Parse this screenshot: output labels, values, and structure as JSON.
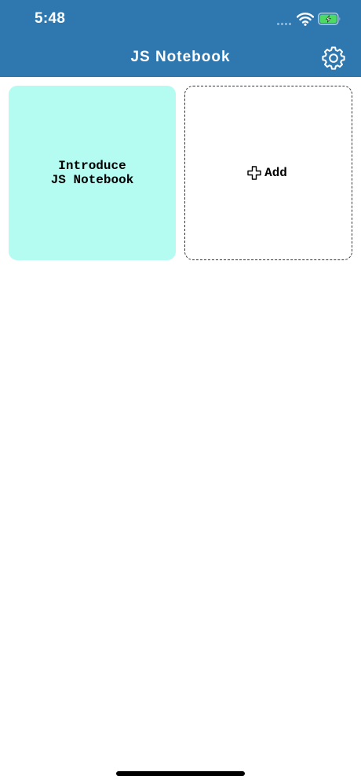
{
  "status_bar": {
    "time": "5:48"
  },
  "header": {
    "title": "JS Notebook",
    "background_color": "#2f78af",
    "settings_icon": "gear-icon"
  },
  "notes": [
    {
      "title": "Introduce\nJS Notebook",
      "background_color": "#b4fbf2"
    }
  ],
  "add_card": {
    "label": "Add",
    "icon": "plus-icon"
  }
}
